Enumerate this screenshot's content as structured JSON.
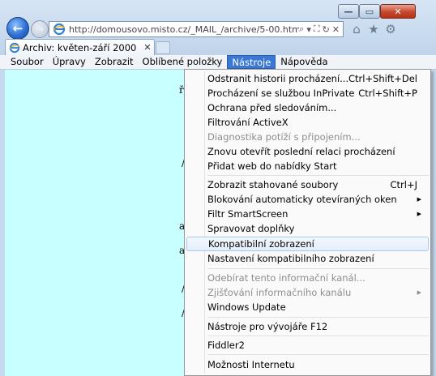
{
  "window": {
    "minimize_icon": "minimize-icon",
    "maximize_icon": "maximize-icon",
    "close_icon": "close-icon",
    "min_glyph": "—",
    "max_glyph": "▭",
    "close_glyph": "✕"
  },
  "nav": {
    "back_glyph": "←",
    "forward_glyph": "→",
    "address": "http://domousovo.misto.cz/_MAIL_/archive/5-00.htm",
    "addr_tools": [
      "⌕",
      "▾",
      "⛶",
      "↻",
      "✕"
    ],
    "home_glyph": "⌂",
    "fav_glyph": "★",
    "gear_glyph": "⚙"
  },
  "tab": {
    "title": "Archiv: květen-září 2000",
    "close_glyph": "✕"
  },
  "menubar": {
    "items": [
      "Soubor",
      "Úpravy",
      "Zobrazit",
      "Oblíbené položky",
      "Nástroje",
      "Nápověda"
    ]
  },
  "content": {
    "fragments": [
      "ř",
      "/",
      "a",
      "a",
      "/",
      "/"
    ]
  },
  "tools_menu": {
    "items": [
      {
        "label": "Odstranit historii procházení...",
        "shortcut": "Ctrl+Shift+Del"
      },
      {
        "label": "Procházení se službou InPrivate",
        "shortcut": "Ctrl+Shift+P"
      },
      {
        "label": "Ochrana před sledováním...",
        "shortcut": ""
      },
      {
        "label": "Filtrování ActiveX",
        "shortcut": ""
      },
      {
        "label": "Diagnostika potíží s připojením...",
        "shortcut": ""
      },
      {
        "label": "Znovu otevřít poslední relaci procházení",
        "shortcut": ""
      },
      {
        "label": "Přidat web do nabídky Start",
        "shortcut": ""
      },
      {
        "label": "Zobrazit stahované soubory",
        "shortcut": "Ctrl+J"
      },
      {
        "label": "Blokování automaticky otevíraných oken",
        "shortcut": ""
      },
      {
        "label": "Filtr SmartScreen",
        "shortcut": ""
      },
      {
        "label": "Spravovat doplňky",
        "shortcut": ""
      },
      {
        "label": "Kompatibilní zobrazení",
        "shortcut": ""
      },
      {
        "label": "Nastavení kompatibilního zobrazení",
        "shortcut": ""
      },
      {
        "label": "Odebírat tento informační kanál...",
        "shortcut": ""
      },
      {
        "label": "Zjišťování informačního kanálu",
        "shortcut": ""
      },
      {
        "label": "Windows Update",
        "shortcut": ""
      },
      {
        "label": "Nástroje pro vývojáře F12",
        "shortcut": ""
      },
      {
        "label": "Fiddler2",
        "shortcut": ""
      },
      {
        "label": "Možnosti Internetu",
        "shortcut": ""
      }
    ],
    "submenu_glyph": "▶"
  },
  "colors": {
    "content_bg": "#c8ffff",
    "menu_active": "#3b78d6",
    "close_button": "#c7472c"
  }
}
